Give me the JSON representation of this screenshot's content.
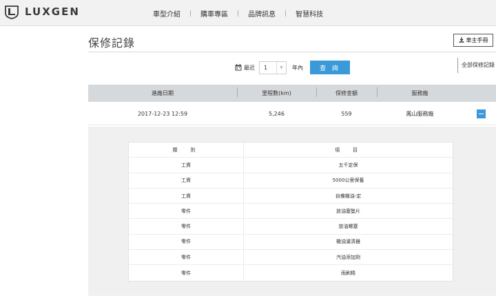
{
  "brand": {
    "name": "LUXGEN",
    "logo_icon": "luxgen-emblem-icon"
  },
  "nav": {
    "items": [
      {
        "label": "車型介紹"
      },
      {
        "label": "購車專區"
      },
      {
        "label": "品牌訊息"
      },
      {
        "label": "智慧科技"
      }
    ],
    "separator": "|"
  },
  "page": {
    "title": "保修記錄",
    "manual_button": {
      "label": "車主手冊",
      "icon": "download-icon"
    }
  },
  "filter": {
    "icon": "calendar-icon",
    "prefix_label": "最近",
    "selected_value": "1",
    "unit_label": "年內",
    "query_button": "查 詢",
    "all_records_link": "全部保修記錄"
  },
  "records_table": {
    "headers": [
      "進廠日期",
      "里程數(km)",
      "保修金額",
      "服務廠"
    ],
    "rows": [
      {
        "date": "2017-12-23 12:59",
        "mileage": "5,246",
        "amount": "559",
        "service_center": "鳳山服務廠"
      }
    ],
    "collapse_icon": "minus-icon"
  },
  "detail_table": {
    "headers": [
      "類　別",
      "項　目"
    ],
    "rows": [
      {
        "category": "工資",
        "item": "五千定保"
      },
      {
        "category": "工資",
        "item": "5000公里保養"
      },
      {
        "category": "工資",
        "item": "自備機油-定"
      },
      {
        "category": "零件",
        "item": "放油塞墊片"
      },
      {
        "category": "零件",
        "item": "放油螺塞"
      },
      {
        "category": "零件",
        "item": "機油濾清器"
      },
      {
        "category": "零件",
        "item": "汽油添加劑"
      },
      {
        "category": "零件",
        "item": "雨刷精"
      }
    ]
  },
  "colors": {
    "accent": "#3a9ad9",
    "header_bg": "#d6d9db",
    "panel_bg": "#f0f0f0",
    "topbar_bg": "#f2f2f2"
  }
}
